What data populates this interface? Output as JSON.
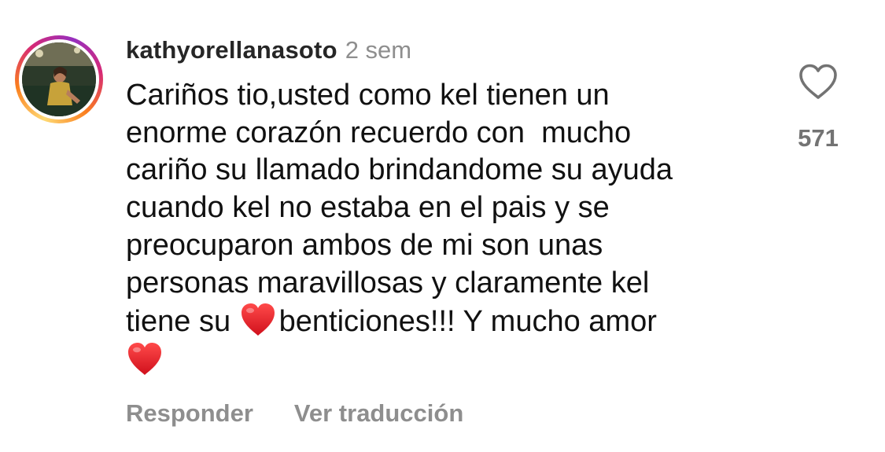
{
  "colors": {
    "username": "#262626",
    "secondary": "#8e8e8e",
    "text": "#111111",
    "heart_emoji": "#e0202a"
  },
  "comment": {
    "avatar_icon": "user-avatar-photo",
    "username": "kathyorellanasoto",
    "time": "2 sem",
    "lines": [
      "Cariños tio,usted como kel tienen un",
      "enorme corazón recuerdo con  mucho",
      "cariño su llamado brindandome su ayuda",
      "cuando kel no estaba en el pais y se",
      "preocuparon ambos de mi son unas",
      "personas maravillosas y claramente kel"
    ],
    "line7_before": "tiene su ",
    "line7_after": "benticiones!!! Y mucho amor",
    "emoji": "red-heart-emoji",
    "like_icon": "heart-outline-icon",
    "like_count": "571",
    "reply_label": "Responder",
    "translate_label": "Ver traducción"
  }
}
